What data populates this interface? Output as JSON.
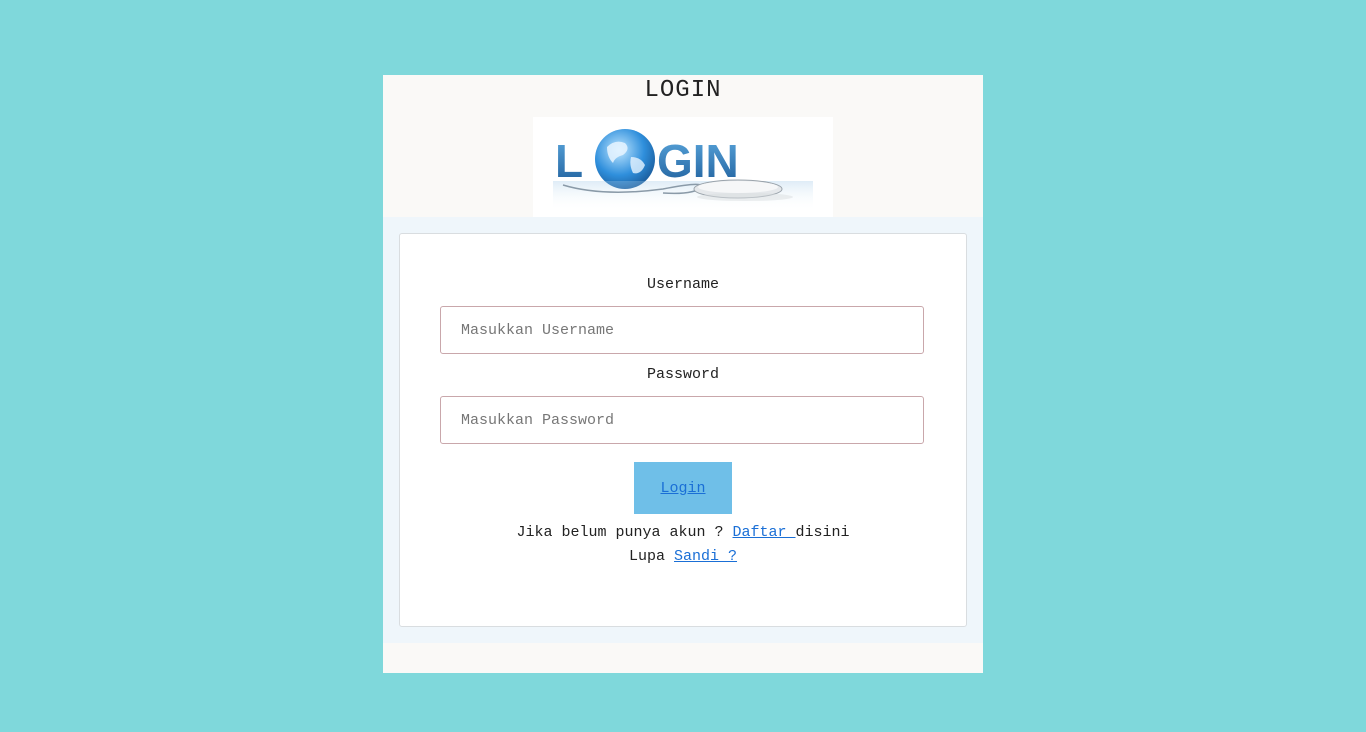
{
  "page": {
    "title": "LOGIN"
  },
  "logo": {
    "text": "LOGIN",
    "colors": {
      "text": "#2a7fc1",
      "globe": "#3a9be0"
    }
  },
  "form": {
    "username_label": "Username",
    "username_placeholder": "Masukkan Username",
    "password_label": "Password",
    "password_placeholder": "Masukkan Password",
    "login_button": "Login",
    "register_prefix": "Jika belum punya akun ? ",
    "register_link": "Daftar ",
    "register_suffix": "disini",
    "forgot_prefix": "Lupa ",
    "forgot_link": "Sandi ?"
  },
  "colors": {
    "background": "#7fd8db",
    "button": "#6fbfe8",
    "link": "#1a6fd6"
  }
}
